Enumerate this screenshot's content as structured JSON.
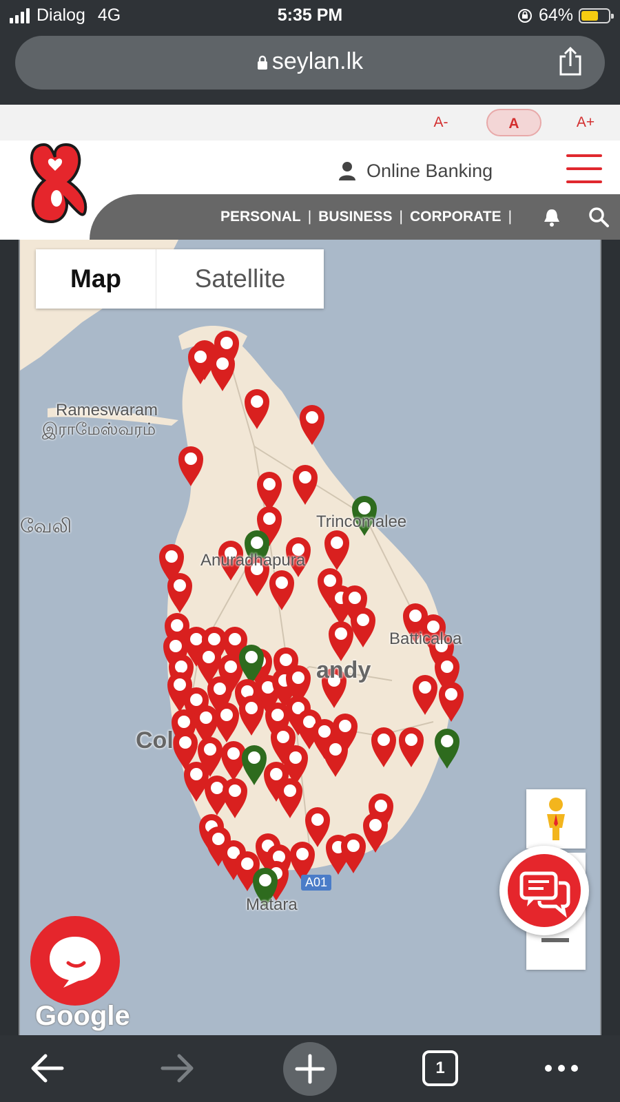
{
  "status_bar": {
    "carrier": "Dialog",
    "network": "4G",
    "time": "5:35 PM",
    "battery_percent": "64%",
    "battery_level": 0.64
  },
  "browser": {
    "url": "seylan.lk",
    "tab_count": "1"
  },
  "accessibility": {
    "decrease": "A-",
    "normal": "A",
    "increase": "A+"
  },
  "header": {
    "online_banking": "Online Banking",
    "nav": [
      "PERSONAL",
      "BUSINESS",
      "CORPORATE"
    ],
    "separator": "|"
  },
  "map": {
    "map_type": {
      "map": "Map",
      "satellite": "Satellite",
      "selected": "Map"
    },
    "labels": {
      "rameswaram": "Rameswaram",
      "rameswaram_tamil": "இராமேஸ்வரம்",
      "velanai": "வேலி",
      "trincomalee": "Trincomalee",
      "anuradhapura": "Anuradhapura",
      "batticaloa": "Batticaloa",
      "kandy": "andy",
      "colombo": "Col",
      "matara": "Matara",
      "route": "A01",
      "google": "Google"
    }
  },
  "colors": {
    "brand_red": "#e0282e",
    "pin_red": "#d9201f",
    "pin_green": "#2e6b1e",
    "land": "#f2e7d6",
    "water": "#aab9c9",
    "nav_band": "#676767"
  },
  "icons": [
    "signal-icon",
    "lock-icon",
    "share-icon",
    "user-icon",
    "menu-icon",
    "bell-icon",
    "search-icon",
    "pegman-icon",
    "chat-icon",
    "message-icon",
    "back-icon",
    "forward-icon",
    "add-icon",
    "more-icon"
  ]
}
